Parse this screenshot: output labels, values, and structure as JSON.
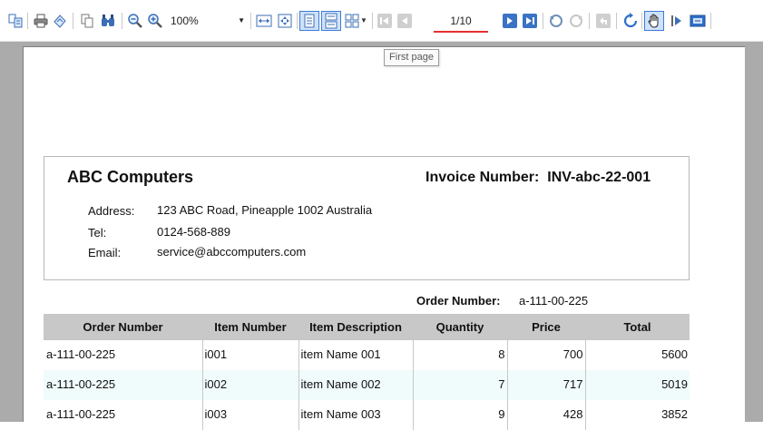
{
  "toolbar": {
    "zoom": "100%",
    "page_indicator": "1/10",
    "tooltip": "First page",
    "icons": [
      "document-map-icon",
      "print-icon",
      "page-setup-icon",
      "copy-icon",
      "find-icon",
      "zoom-out-icon",
      "zoom-in-icon",
      "fit-width-icon",
      "fit-page-icon",
      "single-page-icon",
      "continuous-icon",
      "multipage-icon",
      "first-page-icon",
      "previous-page-icon",
      "next-page-icon",
      "last-page-icon",
      "backward-icon",
      "forward-icon",
      "back-to-parent-icon",
      "refresh-icon",
      "pan-icon",
      "selection-icon",
      "snapshot-icon"
    ]
  },
  "invoice": {
    "company": "ABC Computers",
    "invoice_number_label": "Invoice Number:",
    "invoice_number": "INV-abc-22-001",
    "address_label": "Address:",
    "address": "123 ABC Road, Pineapple 1002 Australia",
    "tel_label": "Tel:",
    "tel": "0124-568-889",
    "email_label": "Email:",
    "email": "service@abccomputers.com",
    "order_number_label": "Order Number:",
    "order_number": "a-111-00-225"
  },
  "table": {
    "headers": [
      "Order Number",
      "Item Number",
      "Item Description",
      "Quantity",
      "Price",
      "Total"
    ],
    "rows": [
      [
        "a-111-00-225",
        "i001",
        "item Name 001",
        "8",
        "700",
        "5600"
      ],
      [
        "a-111-00-225",
        "i002",
        "item Name 002",
        "7",
        "717",
        "5019"
      ],
      [
        "a-111-00-225",
        "i003",
        "item Name 003",
        "9",
        "428",
        "3852"
      ]
    ]
  }
}
